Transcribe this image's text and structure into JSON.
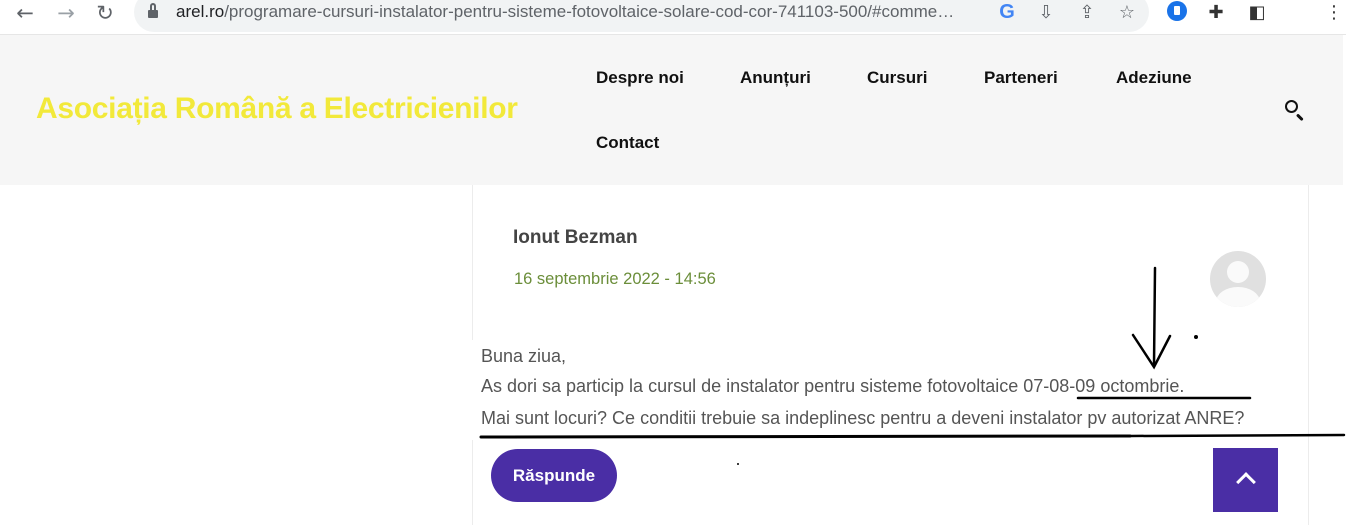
{
  "browser": {
    "url_host": "arel.ro",
    "url_path": "/programare-cursuri-instalator-pentru-sisteme-fotovoltaice-solare-cod-cor-741103-500/#comme…",
    "icons": [
      "back-arrow-icon",
      "forward-arrow-icon",
      "reload-icon",
      "lock-icon",
      "google-icon",
      "install-icon",
      "share-icon",
      "star-icon",
      "extension-blue-icon",
      "puzzle-icon",
      "sidepanel-icon",
      "kebab-menu-icon"
    ]
  },
  "site": {
    "logo": "Asociația Română a Electricienilor",
    "menu": [
      "Despre noi",
      "Anunțuri",
      "Cursuri",
      "Parteneri",
      "Adeziune",
      "Contact"
    ]
  },
  "comment": {
    "author": "Ionut Bezman",
    "date": "16 septembrie 2022 - 14:56",
    "lines": [
      "Buna ziua,",
      "As dori sa particip la cursul de instalator pentru sisteme fotovoltaice  07-08-09 octombrie.",
      "Mai sunt locuri? Ce conditii trebuie sa indeplinesc pentru a deveni  instalator pv autorizat ANRE?"
    ],
    "reply_label": "Răspunde"
  },
  "colors": {
    "logo": "#f2e93a",
    "accent": "#4a2ea5",
    "date": "#6b8e3a"
  }
}
